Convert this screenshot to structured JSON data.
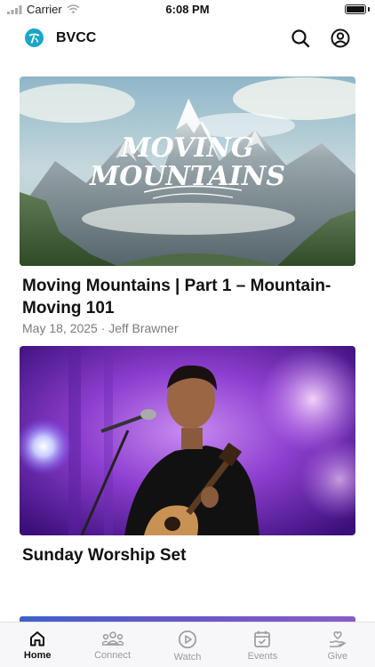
{
  "status_bar": {
    "carrier": "Carrier",
    "time": "6:08 PM"
  },
  "header": {
    "app_name": "BVCC",
    "logo_icon": "swirl-logo",
    "search_icon": "search-icon",
    "profile_icon": "profile-icon"
  },
  "feed": {
    "items": [
      {
        "title": "Moving Mountains | Part 1 – Mountain-Moving 101",
        "meta": "May 18, 2025 · Jeff Brawner",
        "image_text_line1": "MOVING",
        "image_text_line2": "MOUNTAINS"
      },
      {
        "title": "Sunday Worship Set",
        "meta": ""
      }
    ]
  },
  "tab_bar": {
    "tabs": [
      {
        "label": "Home",
        "icon": "home-icon",
        "active": true
      },
      {
        "label": "Connect",
        "icon": "people-icon",
        "active": false
      },
      {
        "label": "Watch",
        "icon": "play-icon",
        "active": false
      },
      {
        "label": "Events",
        "icon": "calendar-icon",
        "active": false
      },
      {
        "label": "Give",
        "icon": "give-hand-icon",
        "active": false
      }
    ]
  },
  "colors": {
    "brand": "#19a7c9",
    "active_tab": "#111111",
    "inactive_tab": "#9a9aa1",
    "meta_text": "#7b7b80"
  }
}
